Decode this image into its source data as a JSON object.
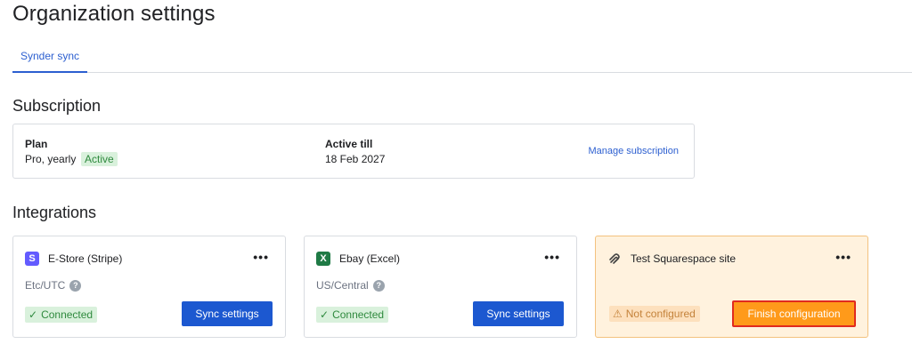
{
  "page": {
    "title": "Organization settings"
  },
  "tabs": [
    {
      "label": "Synder sync",
      "active": true
    }
  ],
  "subscription": {
    "heading": "Subscription",
    "plan_label": "Plan",
    "plan_value": "Pro, yearly",
    "plan_status": "Active",
    "active_till_label": "Active till",
    "active_till_value": "18 Feb 2027",
    "manage_link": "Manage subscription"
  },
  "integrations": {
    "heading": "Integrations",
    "items": [
      {
        "name": "E-Store (Stripe)",
        "icon": "stripe-icon",
        "timezone": "Etc/UTC",
        "status": "Connected",
        "action": "Sync settings"
      },
      {
        "name": "Ebay (Excel)",
        "icon": "excel-icon",
        "timezone": "US/Central",
        "status": "Connected",
        "action": "Sync settings"
      },
      {
        "name": "Test Squarespace site",
        "icon": "squarespace-icon",
        "timezone": "",
        "status": "Not configured",
        "action": "Finish configuration"
      }
    ]
  },
  "colors": {
    "accent": "#1c58d0",
    "success_text": "#2f8a3e",
    "success_bg": "#d9f1dc",
    "warning_bg": "#fff2de",
    "warning_button": "#ff9a1a",
    "highlight_border": "#e02a1e"
  }
}
